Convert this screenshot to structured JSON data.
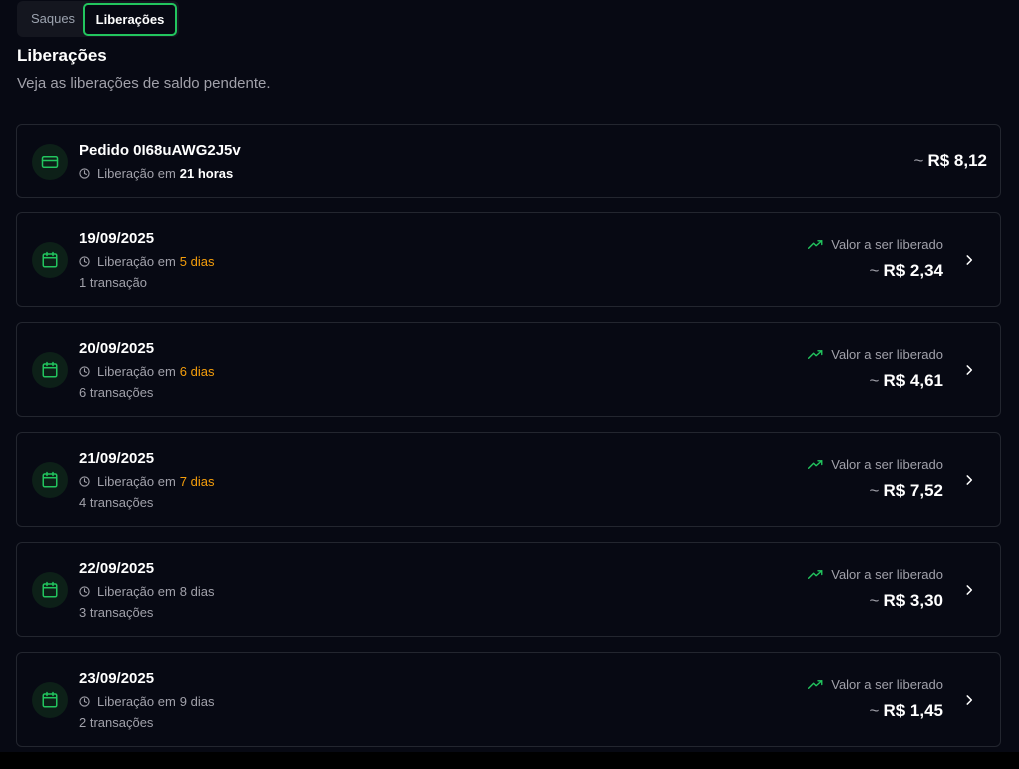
{
  "tabs": {
    "saques": "Saques",
    "liberacoes": "Liberações"
  },
  "header": {
    "title": "Liberações",
    "subtitle": "Veja as liberações de saldo pendente."
  },
  "pending_order": {
    "title": "Pedido 0I68uAWG2J5v",
    "release_prefix": "Liberação em",
    "release_when": "21 horas",
    "amount_prefix": "~",
    "amount": "R$ 8,12"
  },
  "common": {
    "release_prefix": "Liberação em",
    "value_label": "Valor a ser liberado",
    "amount_prefix": "~"
  },
  "colors": {
    "accent_green": "#22c55e",
    "warning_orange": "#f59e0b",
    "background": "#070913"
  },
  "releases": [
    {
      "date": "19/09/2025",
      "when": "5 dias",
      "transactions": "1 transação",
      "amount": "R$ 2,34"
    },
    {
      "date": "20/09/2025",
      "when": "6 dias",
      "transactions": "6 transações",
      "amount": "R$ 4,61"
    },
    {
      "date": "21/09/2025",
      "when": "7 dias",
      "transactions": "4 transações",
      "amount": "R$ 7,52"
    },
    {
      "date": "22/09/2025",
      "when": "8 dias",
      "transactions": "3 transações",
      "amount": "R$ 3,30"
    },
    {
      "date": "23/09/2025",
      "when": "9 dias",
      "transactions": "2 transações",
      "amount": "R$ 1,45"
    }
  ]
}
